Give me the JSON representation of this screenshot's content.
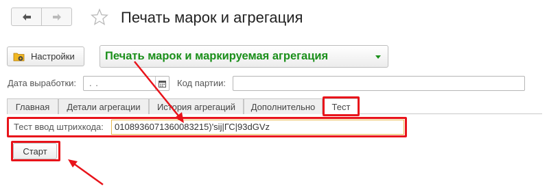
{
  "header": {
    "title": "Печать марок и агрегация"
  },
  "toolbar": {
    "settings_label": "Настройки",
    "print_label": "Печать марок и маркируемая агрегация"
  },
  "fields": {
    "date_label": "Дата выработки:",
    "date_value": ". .",
    "batch_label": "Код партии:",
    "batch_value": ""
  },
  "tabs": [
    {
      "label": "Главная",
      "active": false
    },
    {
      "label": "Детали агрегации",
      "active": false
    },
    {
      "label": "История агрегаций",
      "active": false
    },
    {
      "label": "Дополнительно",
      "active": false
    },
    {
      "label": "Тест",
      "active": true
    }
  ],
  "test": {
    "barcode_label": "Тест ввод штрихкода:",
    "barcode_value": "010893607136008321­5)'sij|ГС|93dGVz",
    "start_label": "Старт"
  },
  "colors": {
    "accent_green": "#1a8f1a",
    "annotation_red": "#e8131a",
    "focus_border": "#e8b84a"
  }
}
